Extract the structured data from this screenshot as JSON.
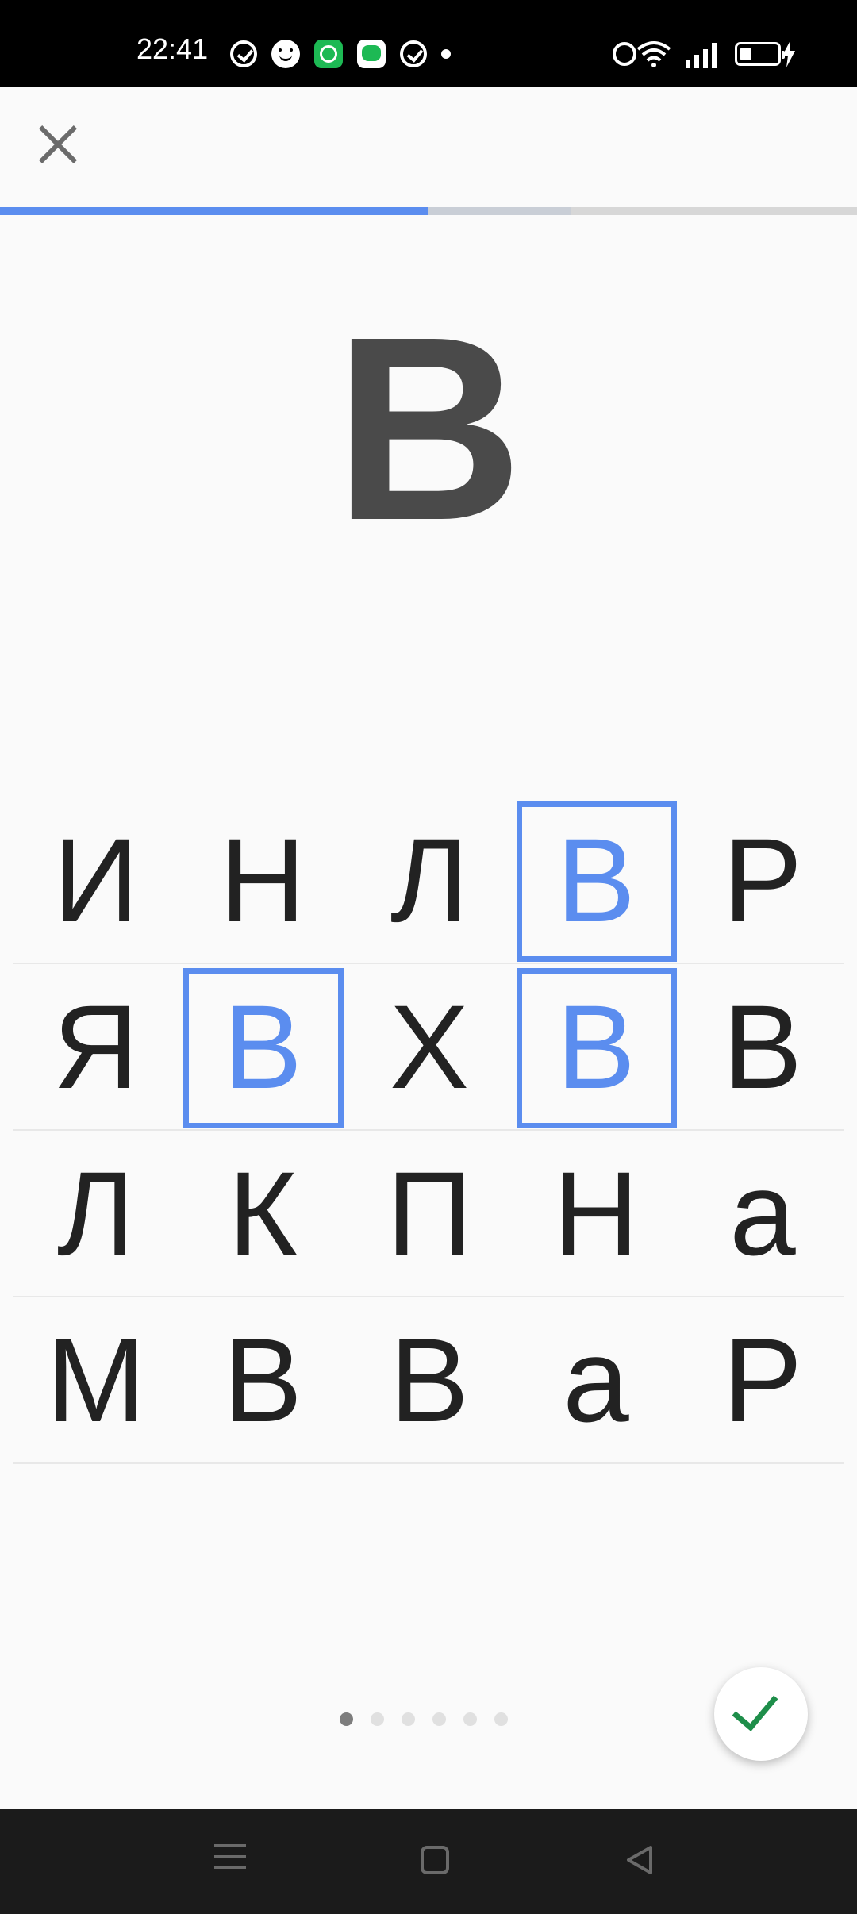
{
  "status_bar": {
    "time": "22:41",
    "left_icons": [
      "check-circle-icon",
      "smiley-face-icon",
      "green-upload-icon",
      "green-message-icon",
      "check-circle-icon",
      "dot-icon"
    ],
    "right_icons": [
      "alarm-icon",
      "wifi-icon",
      "signal-icon",
      "battery-icon",
      "charging-bolt-icon"
    ]
  },
  "header": {
    "close_icon": "close-icon"
  },
  "progress": {
    "value_percent": 50,
    "buffer_percent": 66.7
  },
  "target": {
    "letter": "В"
  },
  "grid": {
    "rows": [
      [
        {
          "letter": "И",
          "selected": false
        },
        {
          "letter": "Н",
          "selected": false
        },
        {
          "letter": "Л",
          "selected": false
        },
        {
          "letter": "В",
          "selected": true
        },
        {
          "letter": "Р",
          "selected": false
        }
      ],
      [
        {
          "letter": "Я",
          "selected": false
        },
        {
          "letter": "В",
          "selected": true
        },
        {
          "letter": "Х",
          "selected": false
        },
        {
          "letter": "В",
          "selected": true
        },
        {
          "letter": "В",
          "selected": false
        }
      ],
      [
        {
          "letter": "Л",
          "selected": false
        },
        {
          "letter": "К",
          "selected": false
        },
        {
          "letter": "П",
          "selected": false
        },
        {
          "letter": "Н",
          "selected": false
        },
        {
          "letter": "а",
          "selected": false
        }
      ],
      [
        {
          "letter": "М",
          "selected": false
        },
        {
          "letter": "В",
          "selected": false
        },
        {
          "letter": "В",
          "selected": false
        },
        {
          "letter": "а",
          "selected": false
        },
        {
          "letter": "Р",
          "selected": false
        }
      ]
    ]
  },
  "pagination": {
    "count": 6,
    "active_index": 0
  },
  "fab": {
    "icon": "checkmark-icon",
    "color": "#1e8e4a"
  },
  "colors": {
    "accent": "#5b8def",
    "target_letter": "#4a4a4a",
    "grid_letter": "#222222"
  },
  "nav_bar": {
    "icons": [
      "menu-icon",
      "home-icon",
      "back-icon"
    ]
  }
}
